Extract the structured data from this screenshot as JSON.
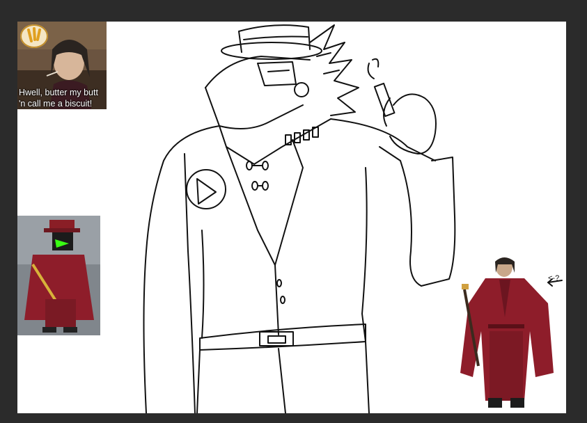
{
  "meme": {
    "caption_line1": "Hwell, butter my butt",
    "caption_line2": "'n call me a biscuit!",
    "icon": "speech-bubble-exclamation-icon"
  },
  "annotation": {
    "arrow_text": "<-?"
  },
  "colors": {
    "background": "#2b2b2b",
    "canvas": "#ffffff",
    "costume_red": "#8e1d2a",
    "roblox_green": "#39ff14"
  }
}
